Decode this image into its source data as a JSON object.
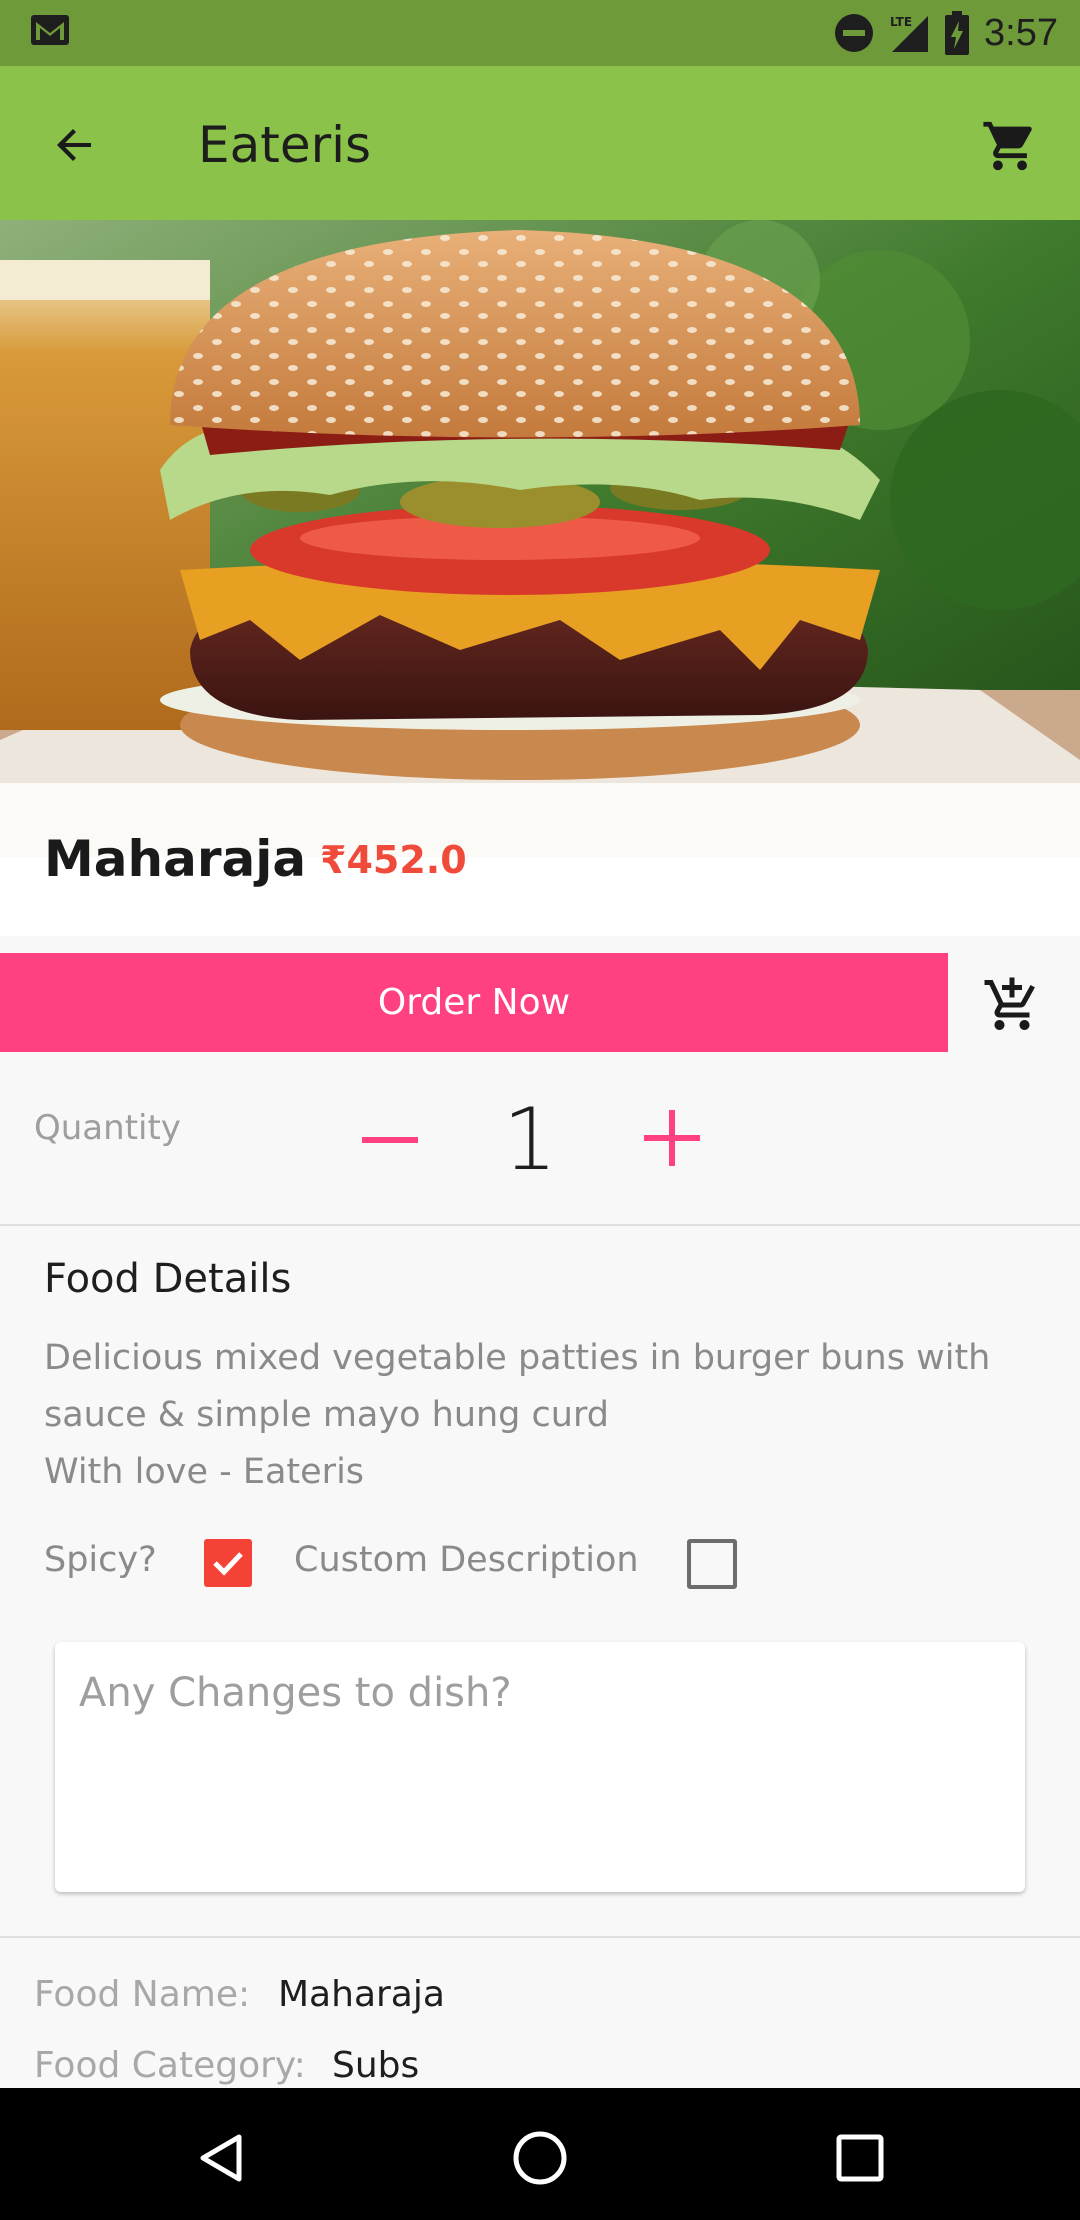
{
  "status_bar": {
    "time": "3:57",
    "network": "LTE",
    "icons": [
      "gmail-icon",
      "do-not-disturb-icon",
      "lte-signal-icon",
      "battery-charging-icon"
    ]
  },
  "app_bar": {
    "title": "Eateris",
    "icons": [
      "back-arrow-icon",
      "cart-icon"
    ]
  },
  "food": {
    "name": "Maharaja",
    "price": "₹452.0"
  },
  "actions": {
    "order_label": "Order Now"
  },
  "quantity": {
    "label": "Quantity",
    "value": "1",
    "minus": "−",
    "plus": "+"
  },
  "details": {
    "title": "Food Details",
    "line1": "Delicious mixed vegetable patties in burger buns with",
    "line2": "sauce & simple mayo hung curd",
    "line3": "With love - Eateris",
    "spicy_label": "Spicy?",
    "spicy_checked": true,
    "custom_label": "Custom Description",
    "custom_checked": false,
    "changes_placeholder": "Any Changes to dish?"
  },
  "info": {
    "name_label": "Food Name:",
    "name_value": "Maharaja",
    "category_label": "Food Category:",
    "category_value": "Subs"
  },
  "colors": {
    "status_bar": "#6e9a3a",
    "app_bar": "#8bc34a",
    "accent": "#ff4081",
    "price": "#f04b3a",
    "checkbox": "#f44336"
  }
}
